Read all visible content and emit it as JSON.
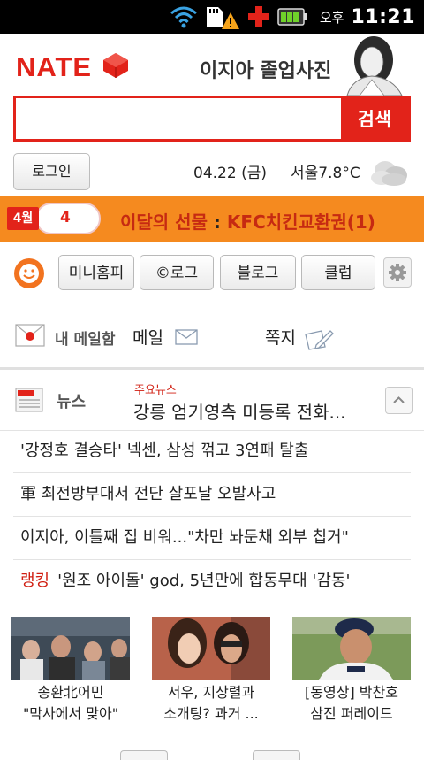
{
  "status_bar": {
    "ampm": "오후",
    "time": "11:21",
    "icons": [
      "wifi-icon",
      "sd-card-icon",
      "warning-icon",
      "red-cross-icon",
      "battery-icon"
    ]
  },
  "header": {
    "logo": "NATE",
    "promo_text": "이지아 졸업사진"
  },
  "search": {
    "value": "",
    "button": "검색"
  },
  "info_bar": {
    "login": "로그인",
    "date": "04.22 (금)",
    "weather": "서울7.8°C"
  },
  "banner": {
    "month": "4월",
    "day": "4",
    "title_prefix": "이달의 선물",
    "colon": " : ",
    "title_main": "KFC치킨교환권(1)"
  },
  "services": {
    "items": [
      "미니홈피",
      "©로그",
      "블로그",
      "클럽"
    ]
  },
  "mail": {
    "label": "내 메일함",
    "mail": "메일",
    "memo": "쪽지"
  },
  "news": {
    "label": "뉴스",
    "sub_label": "주요뉴스",
    "headline": "강릉 엄기영측 미등록 전화...",
    "items": [
      "'강정호 결승타' 넥센, 삼성 꺾고 3연패 탈출",
      "軍 최전방부대서 전단 살포날 오발사고",
      "이지아, 이틀째 집 비워...\"차만 놔둔채 외부 칩거\""
    ],
    "ranking_label": "랭킹",
    "ranking_item": "'원조 아이돌' god, 5년만에 합동무대 '감동'"
  },
  "cards": [
    {
      "line1": "송환北어민",
      "line2": "\"막사에서 맞아\""
    },
    {
      "line1": "서우, 지상렬과",
      "line2": "소개팅? 과거 ..."
    },
    {
      "line1": "[동영상] 박찬호",
      "line2": "삼진 퍼레이드"
    }
  ],
  "colors": {
    "brand_red": "#e2231a",
    "banner_orange": "#f58a1f",
    "status_bar": "#000000"
  }
}
